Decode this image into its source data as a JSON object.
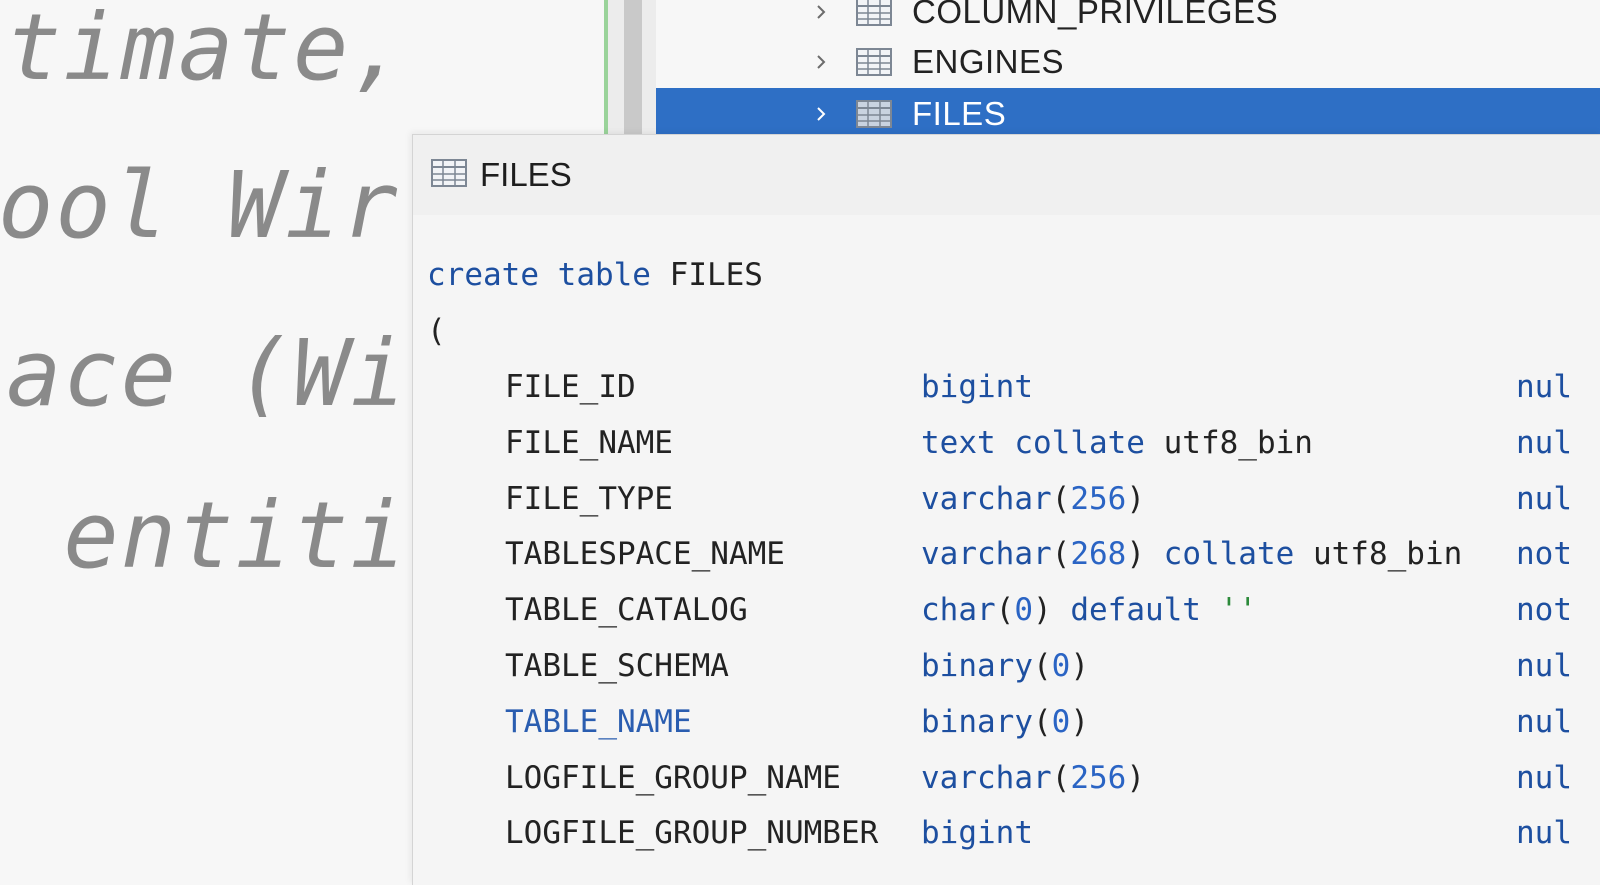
{
  "background_editor": {
    "lines": [
      "timate,",
      "ool Wir",
      "ace (Wi",
      " entiti"
    ]
  },
  "tree": {
    "items": [
      {
        "label": "COLUMN_PRIVILEGES",
        "selected": false
      },
      {
        "label": "ENGINES",
        "selected": false
      },
      {
        "label": "FILES",
        "selected": true
      }
    ]
  },
  "popup": {
    "title": "FILES",
    "ddl": {
      "create_kw": "create",
      "table_kw": "table",
      "table_name": "FILES",
      "open_paren": "(",
      "columns": [
        {
          "name": "FILE_ID",
          "type_parts": [
            {
              "t": "bigint",
              "c": "kw"
            }
          ],
          "tail": "nul"
        },
        {
          "name": "FILE_NAME",
          "type_parts": [
            {
              "t": "text",
              "c": "kw"
            },
            {
              "t": " ",
              "c": ""
            },
            {
              "t": "collate",
              "c": "kw"
            },
            {
              "t": " utf8_bin",
              "c": ""
            }
          ],
          "tail": "nul"
        },
        {
          "name": "FILE_TYPE",
          "type_parts": [
            {
              "t": "varchar",
              "c": "kw"
            },
            {
              "t": "(",
              "c": ""
            },
            {
              "t": "256",
              "c": "num"
            },
            {
              "t": ")",
              "c": ""
            }
          ],
          "tail": "nul"
        },
        {
          "name": "TABLESPACE_NAME",
          "type_parts": [
            {
              "t": "varchar",
              "c": "kw"
            },
            {
              "t": "(",
              "c": ""
            },
            {
              "t": "268",
              "c": "num"
            },
            {
              "t": ") ",
              "c": ""
            },
            {
              "t": "collate",
              "c": "kw"
            },
            {
              "t": " utf8_bin",
              "c": ""
            }
          ],
          "tail": "not"
        },
        {
          "name": "TABLE_CATALOG",
          "type_parts": [
            {
              "t": "char",
              "c": "kw"
            },
            {
              "t": "(",
              "c": ""
            },
            {
              "t": "0",
              "c": "num"
            },
            {
              "t": ") ",
              "c": ""
            },
            {
              "t": "default",
              "c": "kw"
            },
            {
              "t": " ",
              "c": ""
            },
            {
              "t": "''",
              "c": "str"
            }
          ],
          "tail": "not"
        },
        {
          "name": "TABLE_SCHEMA",
          "type_parts": [
            {
              "t": "binary",
              "c": "kw"
            },
            {
              "t": "(",
              "c": ""
            },
            {
              "t": "0",
              "c": "num"
            },
            {
              "t": ")",
              "c": ""
            }
          ],
          "tail": "nul"
        },
        {
          "name": "TABLE_NAME",
          "name_highlight": true,
          "type_parts": [
            {
              "t": "binary",
              "c": "kw"
            },
            {
              "t": "(",
              "c": ""
            },
            {
              "t": "0",
              "c": "num"
            },
            {
              "t": ")",
              "c": ""
            }
          ],
          "tail": "nul"
        },
        {
          "name": "LOGFILE_GROUP_NAME",
          "type_parts": [
            {
              "t": "varchar",
              "c": "kw"
            },
            {
              "t": "(",
              "c": ""
            },
            {
              "t": "256",
              "c": "num"
            },
            {
              "t": ")",
              "c": ""
            }
          ],
          "tail": "nul"
        },
        {
          "name": "LOGFILE_GROUP_NUMBER",
          "type_parts": [
            {
              "t": "bigint",
              "c": "kw"
            }
          ],
          "tail": "nul"
        }
      ]
    }
  },
  "colors": {
    "selection": "#2e6fc5",
    "keyword": "#1d4fa0",
    "number": "#2a64c4",
    "string": "#2c8a3a"
  }
}
